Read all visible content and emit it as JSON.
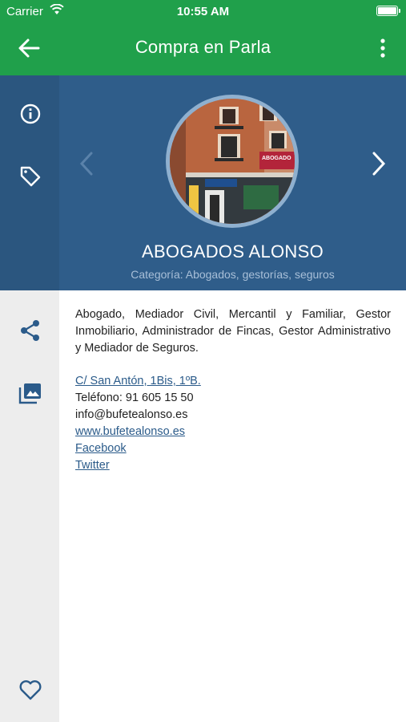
{
  "status_bar": {
    "carrier": "Carrier",
    "time": "10:55 AM",
    "battery_level": 1.0
  },
  "nav": {
    "title": "Compra en Parla"
  },
  "colors": {
    "nav_green": "#20a04b",
    "hero_blue": "#2f5d8a",
    "link_blue": "#2b5b8a",
    "sidebar_gray": "#ededed"
  },
  "business": {
    "name": "ABOGADOS ALONSO",
    "category": "Categoría: Abogados, gestorías, seguros",
    "photo_sign": "ABOGADO",
    "description": "Abogado, Mediador Civil, Mercantil y Familiar, Gestor Inmobiliario, Administrador de Fincas, Gestor Administrativo y Mediador de Seguros.",
    "address": "C/ San Antón, 1Bis, 1ºB.",
    "phone": "Teléfono: 91 605 15 50",
    "email": "info@bufetealonso.es",
    "website": "www.bufetealonso.es",
    "facebook": "Facebook",
    "twitter": "Twitter"
  },
  "icons": {
    "rail": [
      "info-icon",
      "tag-icon"
    ],
    "side": [
      "share-icon",
      "gallery-icon",
      "heart-icon"
    ]
  }
}
